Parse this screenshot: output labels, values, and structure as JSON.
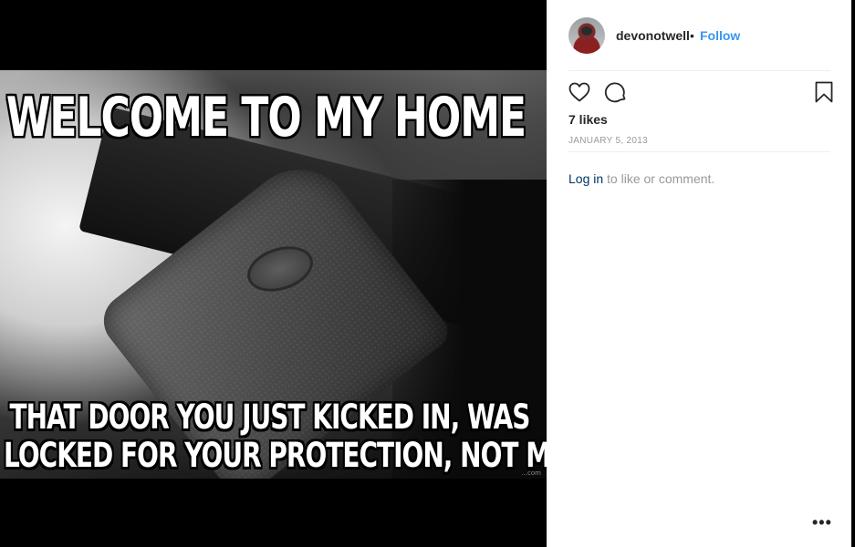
{
  "post": {
    "image": {
      "alt_text_top": "WELCOME TO MY HOME",
      "caption_line1": "THAT DOOR YOU JUST KICKED IN, WAS",
      "caption_line2": "LOCKED FOR YOUR  PROTECTION, NOT MINE.",
      "watermark": "...com"
    }
  },
  "header": {
    "username": "devonotwell",
    "separator": "•",
    "follow_label": "Follow"
  },
  "actions": {
    "like_icon": "heart-outline-icon",
    "comment_icon": "comment-bubble-icon",
    "save_icon": "bookmark-icon"
  },
  "stats": {
    "likes": "7 likes",
    "date": "JANUARY 5, 2013"
  },
  "comment_prompt": {
    "login_label": "Log in",
    "rest": " to like or comment."
  },
  "more_label": "•••",
  "colors": {
    "link_blue": "#3897f0",
    "login_blue": "#003569",
    "muted_grey": "#999999",
    "text_dark": "#262626"
  }
}
